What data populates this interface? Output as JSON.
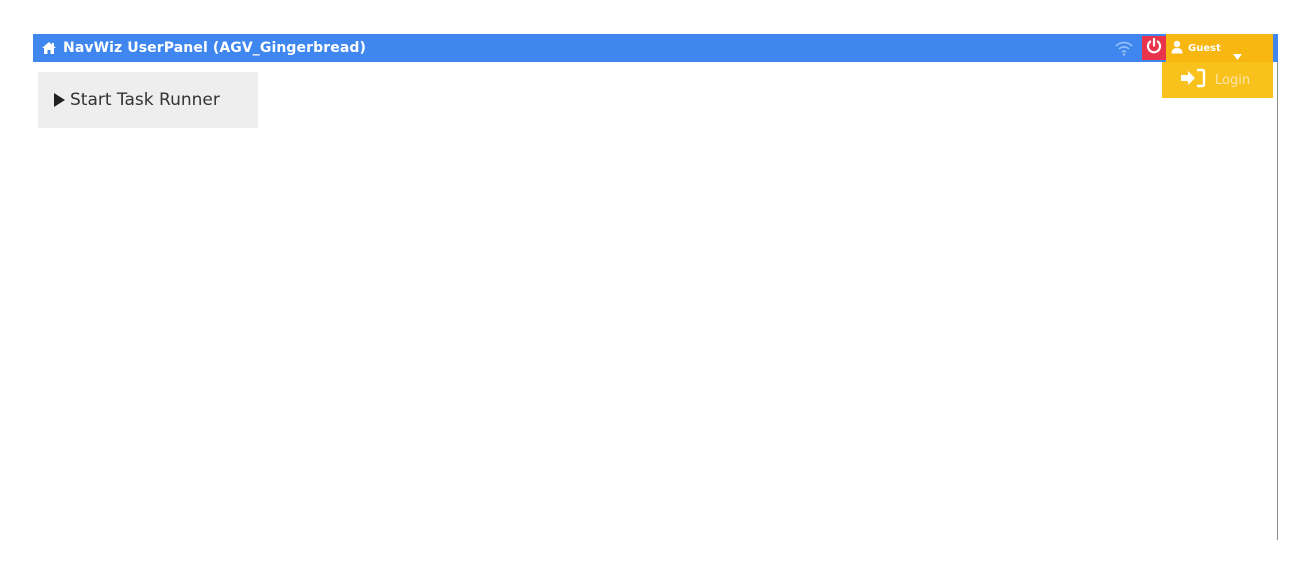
{
  "titlebar": {
    "title": "NavWiz UserPanel (AGV_Gingerbread)",
    "background": "#3f87ef",
    "home_icon": "home-icon"
  },
  "status": {
    "wifi_icon": "wifi-icon",
    "power_icon": "power-icon",
    "power_color": "#e8334a"
  },
  "user_menu": {
    "label": "Guest",
    "user_icon": "user-icon",
    "caret_icon": "caret-down-icon",
    "color": "#f7b610"
  },
  "dropdown": {
    "items": [
      {
        "label": "Login",
        "icon": "sign-in-icon"
      }
    ],
    "color": "#f9c11b"
  },
  "main": {
    "start_button": {
      "label": "Start Task Runner",
      "icon": "play-icon"
    }
  }
}
